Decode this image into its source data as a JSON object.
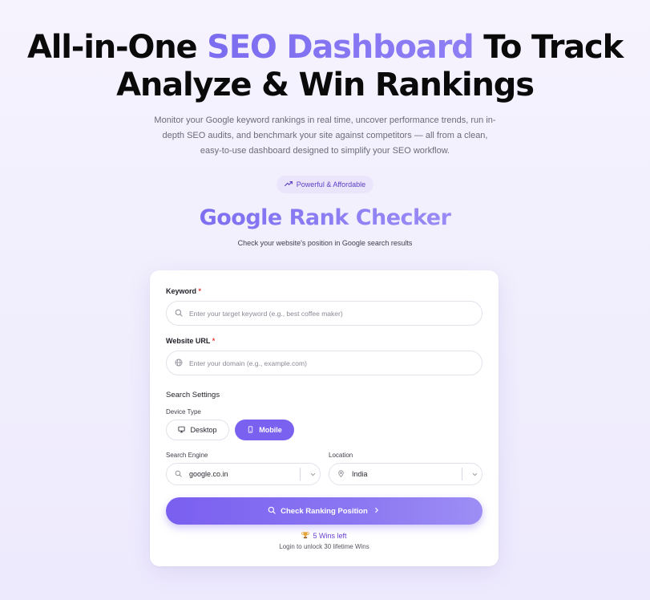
{
  "hero": {
    "title_part1": "All-in-One ",
    "title_accent": "SEO Dashboard",
    "title_part2": " To Track",
    "title_line2": "Analyze & Win Rankings",
    "subtitle": "Monitor your Google keyword rankings in real time, uncover performance trends, run in-depth SEO audits, and benchmark your site against competitors — all from a clean, easy-to-use dashboard designed to simplify your SEO workflow."
  },
  "badge": {
    "label": "Powerful & Affordable",
    "icon": "trending-up-icon"
  },
  "tool": {
    "title": "Google Rank Checker",
    "subtitle": "Check your website's position in Google search results"
  },
  "form": {
    "keyword": {
      "label": "Keyword",
      "required_mark": "*",
      "placeholder": "Enter your target keyword (e.g., best coffee maker)",
      "icon": "search-icon"
    },
    "website": {
      "label": "Website URL",
      "required_mark": "*",
      "placeholder": "Enter your domain (e.g., example.com)",
      "icon": "globe-icon"
    },
    "settings_heading": "Search Settings",
    "device": {
      "label": "Device Type",
      "options": [
        {
          "label": "Desktop",
          "icon": "monitor-icon",
          "selected": false
        },
        {
          "label": "Mobile",
          "icon": "smartphone-icon",
          "selected": true
        }
      ]
    },
    "engine": {
      "label": "Search Engine",
      "value": "google.co.in",
      "icon": "search-icon"
    },
    "location": {
      "label": "Location",
      "value": "India",
      "icon": "map-pin-icon"
    },
    "submit_label": "Check Ranking Position",
    "wins_left": "5 Wins left",
    "login_note": "Login to unlock 30 lifetime Wins"
  },
  "colors": {
    "accent": "#7b61f0",
    "accent_light": "#9d8ef4",
    "badge_bg": "#ebe5fc",
    "required": "#e23b3b"
  }
}
